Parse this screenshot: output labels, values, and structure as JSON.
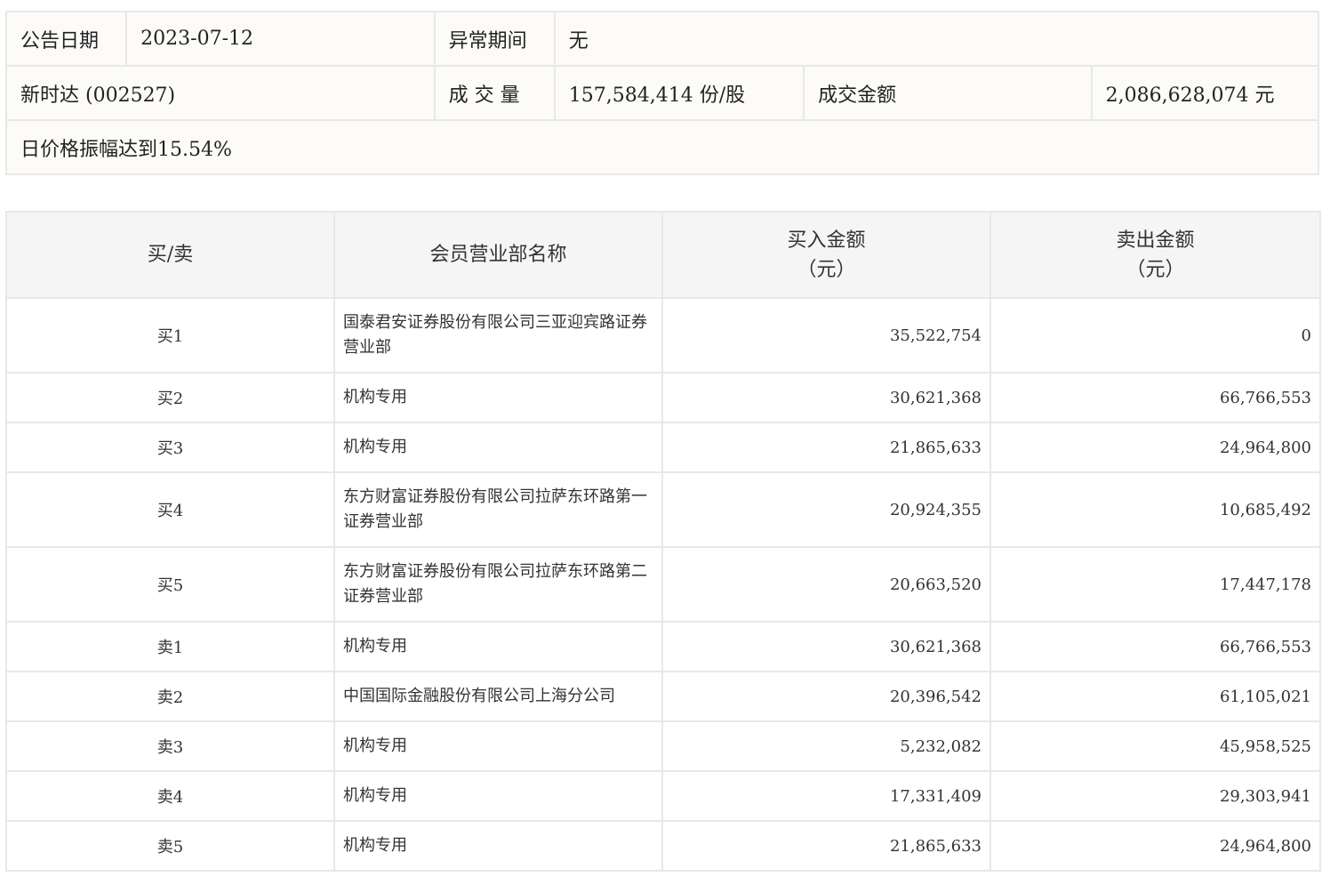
{
  "announcement": {
    "date_label": "公告日期",
    "date_value": "2023-07-12",
    "abnormal_period_label": "异常期间",
    "abnormal_period_value": "无",
    "stock_name": "新时达 (002527)",
    "volume_label": "成 交 量",
    "volume_value": "157,584,414 份/股",
    "turnover_label": "成交金额",
    "turnover_value": "2,086,628,074 元",
    "reason": "日价格振幅达到15.54%"
  },
  "trades": {
    "headers": {
      "side": "买/卖",
      "member": "会员营业部名称",
      "buy_amount": "买入金额",
      "buy_unit": "（元）",
      "sell_amount": "卖出金额",
      "sell_unit": "（元）"
    },
    "rows": [
      {
        "side": "买1",
        "member": "国泰君安证券股份有限公司三亚迎宾路证券营业部",
        "buy": "35,522,754",
        "sell": "0"
      },
      {
        "side": "买2",
        "member": "机构专用",
        "buy": "30,621,368",
        "sell": "66,766,553"
      },
      {
        "side": "买3",
        "member": "机构专用",
        "buy": "21,865,633",
        "sell": "24,964,800"
      },
      {
        "side": "买4",
        "member": "东方财富证券股份有限公司拉萨东环路第一证券营业部",
        "buy": "20,924,355",
        "sell": "10,685,492"
      },
      {
        "side": "买5",
        "member": "东方财富证券股份有限公司拉萨东环路第二证券营业部",
        "buy": "20,663,520",
        "sell": "17,447,178"
      },
      {
        "side": "卖1",
        "member": "机构专用",
        "buy": "30,621,368",
        "sell": "66,766,553"
      },
      {
        "side": "卖2",
        "member": "中国国际金融股份有限公司上海分公司",
        "buy": "20,396,542",
        "sell": "61,105,021"
      },
      {
        "side": "卖3",
        "member": "机构专用",
        "buy": "5,232,082",
        "sell": "45,958,525"
      },
      {
        "side": "卖4",
        "member": "机构专用",
        "buy": "17,331,409",
        "sell": "29,303,941"
      },
      {
        "side": "卖5",
        "member": "机构专用",
        "buy": "21,865,633",
        "sell": "24,964,800"
      }
    ]
  }
}
